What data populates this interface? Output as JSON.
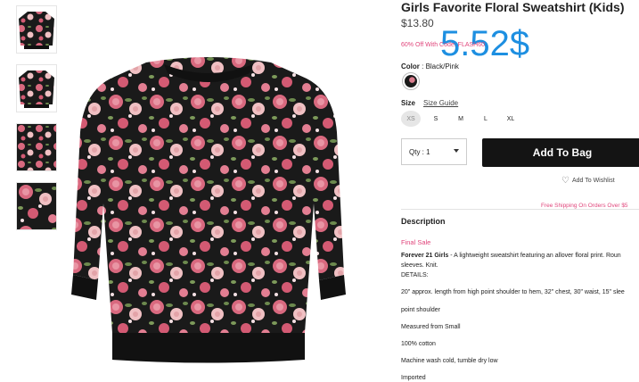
{
  "product": {
    "title": "Girls Favorite Floral Sweatshirt (Kids)",
    "price": "$13.80",
    "overlay_price": "5.52$",
    "promo": "60% Off With Code: FLASH60"
  },
  "color": {
    "label": "Color",
    "value": ": Black/Pink"
  },
  "size": {
    "label": "Size",
    "guide_link": "Size Guide",
    "options": [
      "XS",
      "S",
      "M",
      "L",
      "XL"
    ],
    "selected": "XS"
  },
  "actions": {
    "qty_label": "Qty : 1",
    "add_to_bag": "Add To Bag",
    "wishlist": "Add To Wishlist",
    "shipping": "Free Shipping On Orders Over $5"
  },
  "description": {
    "heading": "Description",
    "final_sale": "Final Sale",
    "intro_bold": "Forever 21 Girls",
    "intro_text": " - A lightweight sweatshirt featuring an allover floral print. Roun",
    "intro_cont": "sleeves. Knit.",
    "details_label": "DETAILS:",
    "lines": [
      "20\" approx. length from high point shoulder to hem, 32\" chest, 30\" waist, 15\" slee",
      "point shoulder",
      "Measured from Small",
      "100% cotton",
      "Machine wash cold, tumble dry low",
      "Imported"
    ]
  },
  "thumbnails": [
    "front-view-thumb",
    "back-view-thumb",
    "detail-view-thumb",
    "fabric-view-thumb"
  ],
  "colors": {
    "accent_pink": "#e0457b",
    "overlay_blue": "#1d8fe1",
    "button_black": "#141414"
  }
}
